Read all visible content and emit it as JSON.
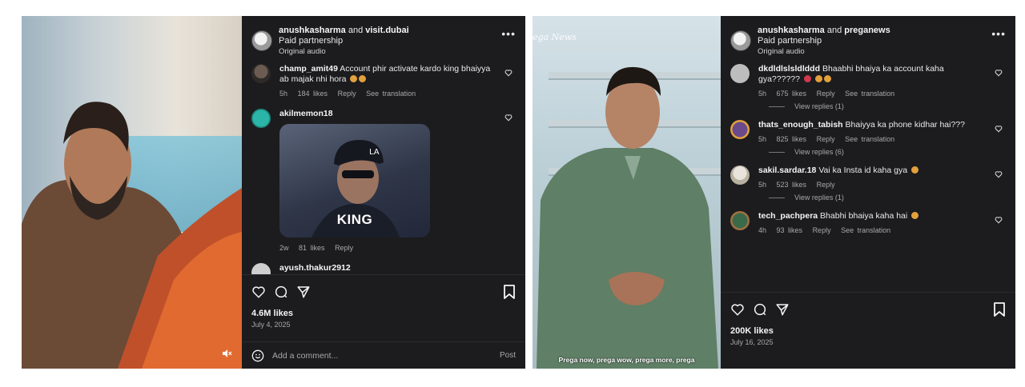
{
  "left_post": {
    "header": {
      "user1": "anushkasharma",
      "joiner": "and",
      "user2": "visit.dubai",
      "partnership": "Paid partnership",
      "audio": "Original audio"
    },
    "comments": [
      {
        "user": "champ_amit49",
        "text": "Account phir activate kardo king bhaiyya ab majak nhi hora",
        "time": "5h",
        "likes": "184 likes",
        "reply": "Reply",
        "translate": "See translation"
      },
      {
        "user": "akilmemon18",
        "gif_caption": "KING",
        "time": "2w",
        "likes": "81 likes",
        "reply": "Reply"
      },
      {
        "user": "ayush.thakur2912"
      }
    ],
    "likes": "4.6M likes",
    "date": "July 4, 2025",
    "add_comment_placeholder": "Add a comment...",
    "post_label": "Post"
  },
  "right_post": {
    "header": {
      "user1": "anushkasharma",
      "joiner": "and",
      "user2": "preganews",
      "partnership": "Paid partnership",
      "audio": "Original audio"
    },
    "comments": [
      {
        "user": "dkdldlslsldlddd",
        "text": "Bhaabhi bhaiya ka account kaha gya??????",
        "time": "5h",
        "likes": "675 likes",
        "reply": "Reply",
        "translate": "See translation",
        "view_replies": "View replies (1)"
      },
      {
        "user": "thats_enough_tabish",
        "text": "Bhaiyya ka phone kidhar hai???",
        "time": "5h",
        "likes": "825 likes",
        "reply": "Reply",
        "translate": "See translation",
        "view_replies": "View replies (6)"
      },
      {
        "user": "sakil.sardar.18",
        "text": "Vai ka Insta id kaha gya",
        "time": "5h",
        "likes": "523 likes",
        "reply": "Reply",
        "view_replies": "View replies (1)"
      },
      {
        "user": "tech_pachpera",
        "text": "Bhabhi bhaiya kaha hai",
        "time": "4h",
        "likes": "93 likes",
        "reply": "Reply",
        "translate": "See translation"
      }
    ],
    "likes": "200K likes",
    "date": "July 16, 2025",
    "brand_overlay": "ega News",
    "subtitle": "Prega now, prega wow, prega more, prega"
  },
  "icons": [
    "more-icon",
    "heart-icon",
    "comment-icon",
    "share-icon",
    "bookmark-icon",
    "emoji-icon",
    "mute-icon"
  ],
  "colors": {
    "panel_bg": "#1c1c1e",
    "text": "#f5f5f5",
    "muted": "#a8a8a8"
  }
}
